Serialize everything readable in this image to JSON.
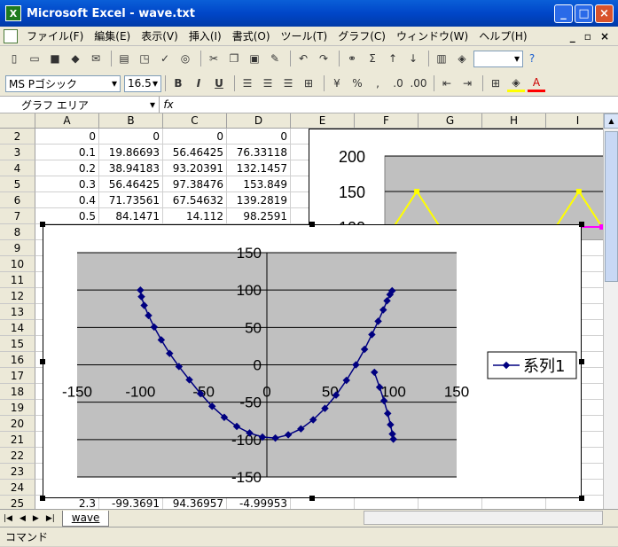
{
  "window": {
    "title": "Microsoft Excel - wave.txt",
    "app_icon": "X"
  },
  "menu": [
    "ファイル(F)",
    "編集(E)",
    "表示(V)",
    "挿入(I)",
    "書式(O)",
    "ツール(T)",
    "グラフ(C)",
    "ウィンドウ(W)",
    "ヘルプ(H)"
  ],
  "font": {
    "name": "MS Pゴシック",
    "size": "16.5"
  },
  "formula": {
    "namebox": "グラフ エリア",
    "fx": "fx"
  },
  "columns": [
    "A",
    "B",
    "C",
    "D",
    "E",
    "F",
    "G",
    "H",
    "I"
  ],
  "rows": [
    {
      "n": "2",
      "a": "0",
      "b": "0",
      "c": "0",
      "d": "0"
    },
    {
      "n": "3",
      "a": "0.1",
      "b": "19.86693",
      "c": "56.46425",
      "d": "76.33118"
    },
    {
      "n": "4",
      "a": "0.2",
      "b": "38.94183",
      "c": "93.20391",
      "d": "132.1457"
    },
    {
      "n": "5",
      "a": "0.3",
      "b": "56.46425",
      "c": "97.38476",
      "d": "153.849"
    },
    {
      "n": "6",
      "a": "0.4",
      "b": "71.73561",
      "c": "67.54632",
      "d": "139.2819"
    },
    {
      "n": "7",
      "a": "0.5",
      "b": "84.1471",
      "c": "14.112",
      "d": "98.2591"
    },
    {
      "n": "8"
    },
    {
      "n": "9"
    },
    {
      "n": "10"
    },
    {
      "n": "11"
    },
    {
      "n": "12"
    },
    {
      "n": "13"
    },
    {
      "n": "14"
    },
    {
      "n": "15"
    },
    {
      "n": "16"
    },
    {
      "n": "17"
    },
    {
      "n": "18"
    },
    {
      "n": "19"
    },
    {
      "n": "20"
    },
    {
      "n": "21"
    },
    {
      "n": "22"
    },
    {
      "n": "23"
    },
    {
      "n": "24"
    },
    {
      "n": "25",
      "a": "2.3",
      "b": "-99.3691",
      "c": "94.36957",
      "d": "-4.99953"
    }
  ],
  "sheet_tab": "wave",
  "status": "コマンド",
  "chart_data": [
    {
      "type": "line",
      "role": "background",
      "ylim": [
        0,
        200
      ],
      "yticks": [
        "200",
        "150",
        "100"
      ],
      "colors": {
        "series_a": "#ffff00",
        "series_b": "#ff00ff",
        "series_c": "#000080",
        "plot_bg": "#c0c0c0"
      },
      "series": [
        {
          "values": [
            100,
            150,
            100,
            100,
            100,
            98,
            100,
            100,
            150,
            100
          ]
        },
        {
          "values": [
            100,
            100,
            100,
            100,
            100,
            98,
            100,
            98,
            100,
            100
          ]
        }
      ]
    },
    {
      "type": "scatter",
      "xlim": [
        -150,
        150
      ],
      "ylim": [
        -150,
        150
      ],
      "xticks": [
        "-150",
        "-100",
        "-50",
        "0",
        "50",
        "100",
        "150"
      ],
      "yticks": [
        "150",
        "100",
        "50",
        "0",
        "-50",
        "-100",
        "-150"
      ],
      "legend": "right",
      "colors": {
        "series": "#000080",
        "plot_bg": "#c0c0c0"
      },
      "series": [
        {
          "name": "系列1",
          "x": [
            -100,
            -99.2,
            -97,
            -93.6,
            -89.1,
            -83.5,
            -76.9,
            -69.5,
            -61.3,
            -52.5,
            -43.3,
            -33.7,
            -23.8,
            -13.7,
            -3.5,
            6.7,
            16.9,
            26.9,
            36.6,
            45.9,
            54.7,
            62.9,
            70.4,
            77.2,
            83,
            88,
            92,
            95,
            97.3,
            99
          ],
          "y": [
            99.9,
            91.2,
            79.5,
            66,
            50.5,
            33.4,
            15.2,
            -2.3,
            -20,
            -38.5,
            -55.5,
            -70.2,
            -82.4,
            -91.2,
            -96.6,
            -98,
            -93.6,
            -85.6,
            -73.5,
            -58.3,
            -40.5,
            -20.7,
            0,
            20.7,
            40.5,
            58.3,
            73.5,
            85.6,
            94,
            99
          ]
        },
        {
          "x": [
            100,
            99.2,
            97.7,
            95.5,
            92.6,
            89.1,
            85
          ],
          "y": [
            -99.4,
            -92.5,
            -80,
            -65,
            -48,
            -30,
            -10
          ]
        }
      ]
    }
  ]
}
